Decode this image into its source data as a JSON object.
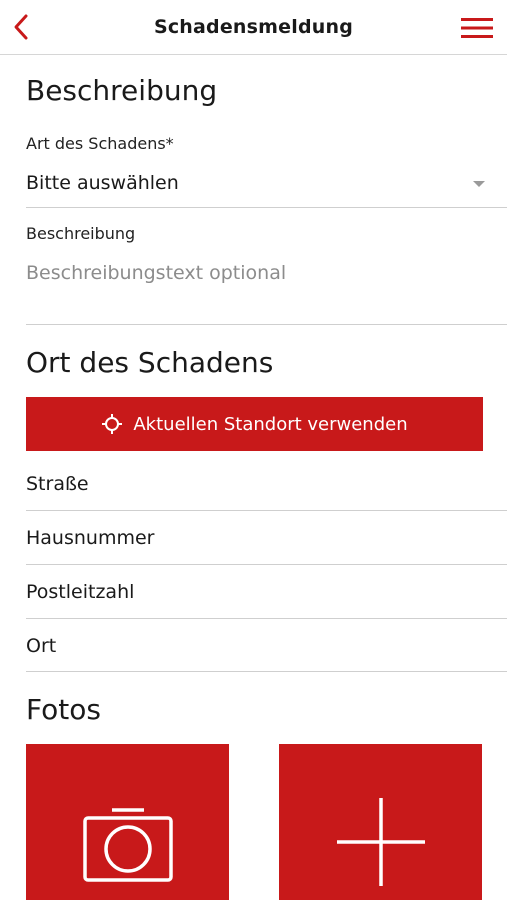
{
  "header": {
    "title": "Schadensmeldung",
    "back_icon": "chevron-left-icon",
    "menu_icon": "hamburger-menu-icon"
  },
  "colors": {
    "accent": "#c8191a",
    "text": "#1a1a1a",
    "placeholder": "#8c8c8c",
    "divider": "#cfcfcf"
  },
  "beschreibung": {
    "section_title": "Beschreibung",
    "damage_type_label": "Art des Schadens*",
    "damage_type_value": "Bitte auswählen",
    "description_label": "Beschreibung",
    "description_placeholder": "Beschreibungstext optional"
  },
  "ort": {
    "section_title": "Ort des Schadens",
    "location_button_label": "Aktuellen Standort verwenden",
    "location_icon": "crosshair-icon",
    "fields": [
      "Straße",
      "Hausnummer",
      "Postleitzahl",
      "Ort"
    ]
  },
  "fotos": {
    "section_title": "Fotos",
    "tiles": [
      {
        "icon": "camera-icon"
      },
      {
        "icon": "plus-icon"
      }
    ]
  }
}
